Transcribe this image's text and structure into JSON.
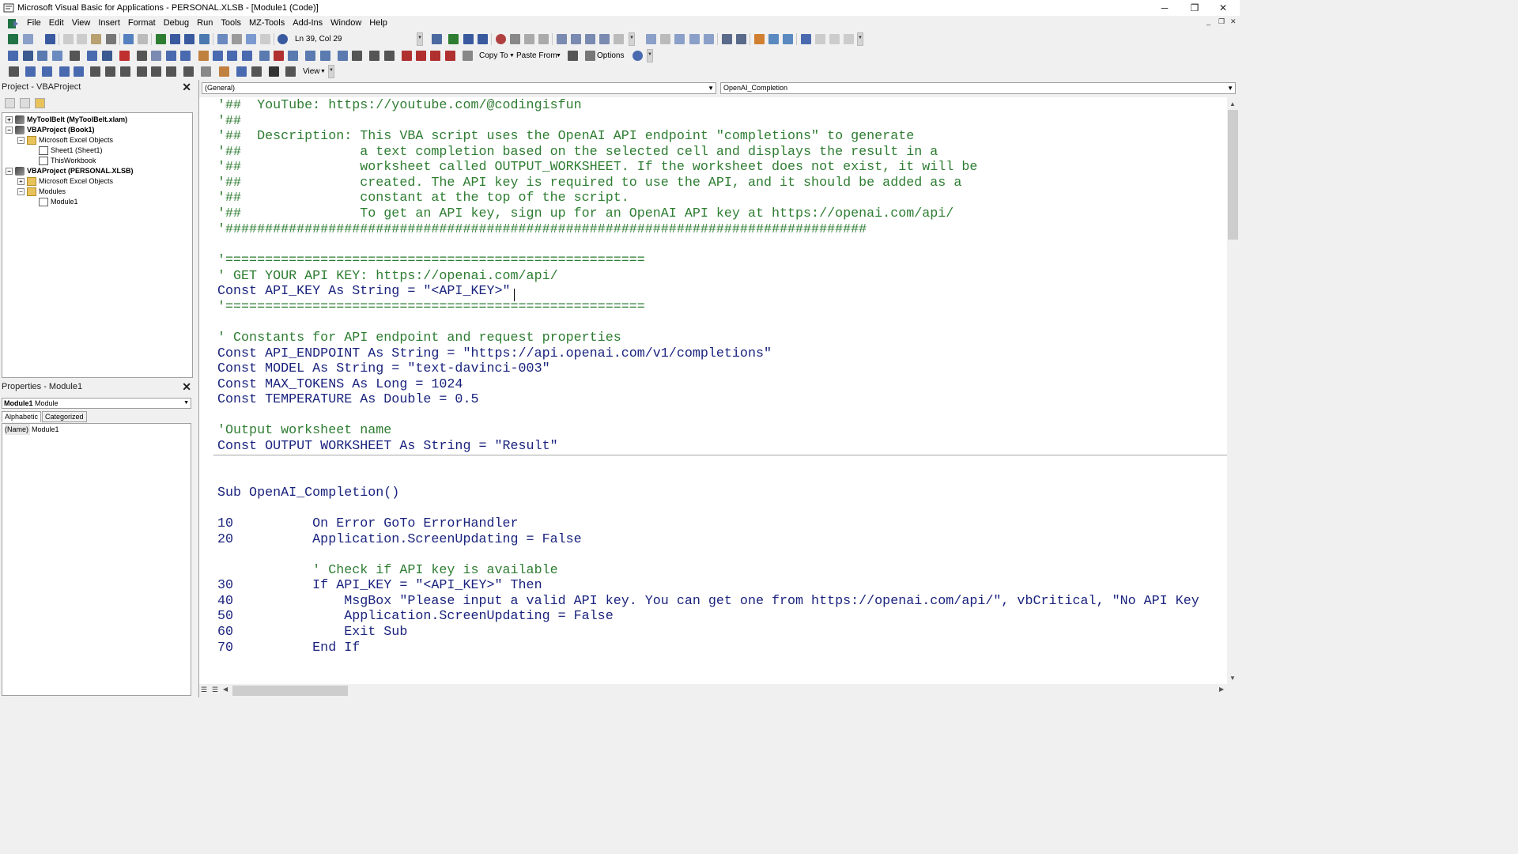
{
  "window": {
    "title": "Microsoft Visual Basic for Applications - PERSONAL.XLSB - [Module1 (Code)]"
  },
  "menu": [
    "File",
    "Edit",
    "View",
    "Insert",
    "Format",
    "Debug",
    "Run",
    "Tools",
    "MZ-Tools",
    "Add-Ins",
    "Window",
    "Help"
  ],
  "toolbar": {
    "position": "Ln 39, Col 29",
    "copy_to": "Copy To",
    "paste_from": "Paste From",
    "options": "Options",
    "view": "View"
  },
  "project_panel": {
    "title": "Project - VBAProject",
    "tree": [
      {
        "label": "MyToolBelt (MyToolBelt.xlam)",
        "bold": true
      },
      {
        "label": "VBAProject (Book1)",
        "bold": true
      },
      {
        "label": "Microsoft Excel Objects",
        "bold": false
      },
      {
        "label": "Sheet1 (Sheet1)",
        "bold": false
      },
      {
        "label": "ThisWorkbook",
        "bold": false
      },
      {
        "label": "VBAProject (PERSONAL.XLSB)",
        "bold": true
      },
      {
        "label": "Microsoft Excel Objects",
        "bold": false
      },
      {
        "label": "Modules",
        "bold": false
      },
      {
        "label": "Module1",
        "bold": false
      }
    ]
  },
  "properties_panel": {
    "title": "Properties - Module1",
    "object_name": "Module1",
    "object_type": "Module",
    "tabs": [
      "Alphabetic",
      "Categorized"
    ],
    "rows": [
      {
        "name": "(Name)",
        "value": "Module1"
      }
    ]
  },
  "code_window": {
    "object_combo": "(General)",
    "procedure_combo": "OpenAI_Completion",
    "lines": [
      "'##  YouTube: https://youtube.com/@codingisfun",
      "'##",
      "'##  Description: This VBA script uses the OpenAI API endpoint \"completions\" to generate",
      "'##               a text completion based on the selected cell and displays the result in a",
      "'##               worksheet called OUTPUT_WORKSHEET. If the worksheet does not exist, it will be",
      "'##               created. The API key is required to use the API, and it should be added as a",
      "'##               constant at the top of the script.",
      "'##               To get an API key, sign up for an OpenAI API key at https://openai.com/api/",
      "'#################################################################################",
      "",
      "'=====================================================",
      "' GET YOUR API KEY: https://openai.com/api/",
      "Const API_KEY As String = \"<API_KEY>\"",
      "'=====================================================",
      "",
      "' Constants for API endpoint and request properties",
      "Const API_ENDPOINT As String = \"https://api.openai.com/v1/completions\"",
      "Const MODEL As String = \"text-davinci-003\"",
      "Const MAX_TOKENS As Long = 1024",
      "Const TEMPERATURE As Double = 0.5",
      "",
      "'Output worksheet name",
      "Const OUTPUT WORKSHEET As String = \"Result\"",
      "",
      "",
      "Sub OpenAI_Completion()",
      "",
      "10          On Error GoTo ErrorHandler",
      "20          Application.ScreenUpdating = False",
      "",
      "            ' Check if API key is available",
      "30          If API_KEY = \"<API_KEY>\" Then",
      "40              MsgBox \"Please input a valid API key. You can get one from https://openai.com/api/\", vbCritical, \"No API Key",
      "50              Application.ScreenUpdating = False",
      "60              Exit Sub",
      "70          End If"
    ]
  },
  "colors": {
    "comment": "#2e7d32",
    "keyword": "#1a237e",
    "text": "#000000"
  }
}
